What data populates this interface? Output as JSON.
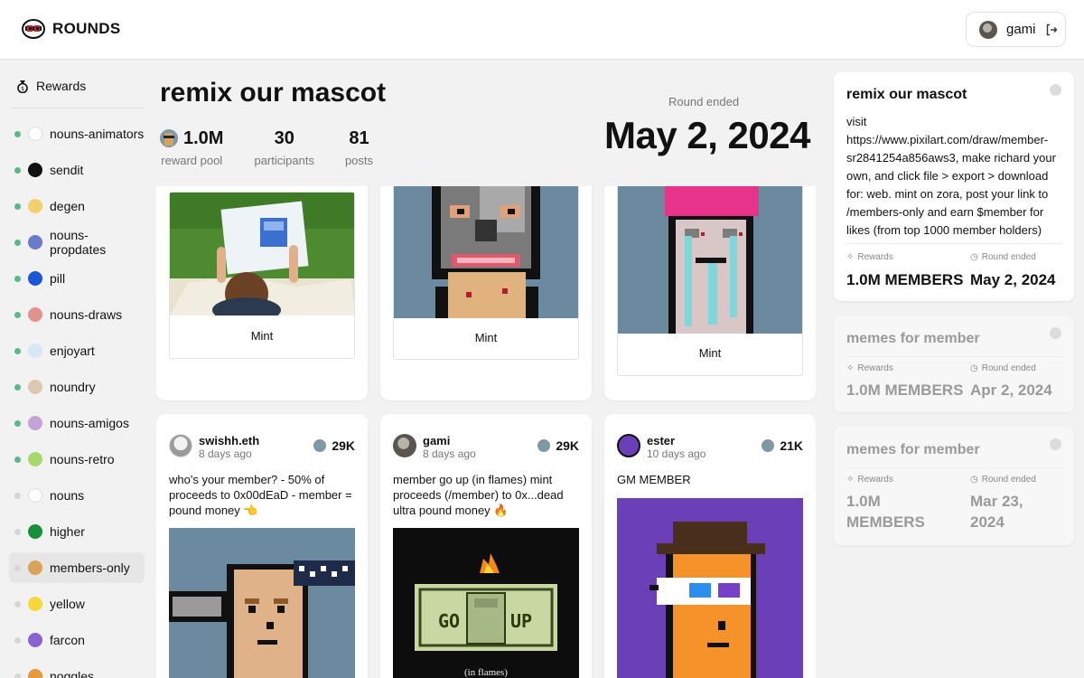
{
  "brand": {
    "name": "ROUNDS"
  },
  "user": {
    "name": "gami"
  },
  "sidebar": {
    "rewards_label": "Rewards",
    "channels": [
      {
        "label": "nouns-animators",
        "live": true,
        "icon_color": "#ffffff",
        "icon": "nouns-animators-icon"
      },
      {
        "label": "sendit",
        "live": true,
        "icon_color": "#111111",
        "icon": "sendit-icon"
      },
      {
        "label": "degen",
        "live": true,
        "icon_color": "#f3d16a",
        "icon": "degen-icon"
      },
      {
        "label": "nouns-propdates",
        "live": true,
        "icon_color": "#6b7ac9",
        "icon": "nouns-propdates-icon"
      },
      {
        "label": "pill",
        "live": true,
        "icon_color": "#1b58d6",
        "icon": "pill-icon"
      },
      {
        "label": "nouns-draws",
        "live": true,
        "icon_color": "#e1928b",
        "icon": "nouns-draws-icon"
      },
      {
        "label": "enjoyart",
        "live": true,
        "icon_color": "#d9e6f3",
        "icon": "enjoyart-icon"
      },
      {
        "label": "noundry",
        "live": true,
        "icon_color": "#dcc8b0",
        "icon": "noundry-icon"
      },
      {
        "label": "nouns-amigos",
        "live": true,
        "icon_color": "#c5a2d8",
        "icon": "nouns-amigos-icon"
      },
      {
        "label": "nouns-retro",
        "live": true,
        "icon_color": "#a7d86e",
        "icon": "nouns-retro-icon"
      },
      {
        "label": "nouns",
        "live": false,
        "icon_color": "#ffffff",
        "icon": "nouns-icon"
      },
      {
        "label": "higher",
        "live": false,
        "icon_color": "#1a8f3a",
        "icon": "higher-icon"
      },
      {
        "label": "members-only",
        "live": false,
        "icon_color": "#d9a35a",
        "icon": "members-only-icon",
        "active": true
      },
      {
        "label": "yellow",
        "live": false,
        "icon_color": "#f6d83a",
        "icon": "yellow-icon"
      },
      {
        "label": "farcon",
        "live": false,
        "icon_color": "#8a63d2",
        "icon": "farcon-icon"
      },
      {
        "label": "noggles",
        "live": false,
        "icon_color": "#e79a3a",
        "icon": "noggles-icon"
      }
    ]
  },
  "round": {
    "title": "remix our mascot",
    "reward_pool": "1.0M",
    "reward_pool_label": "reward pool",
    "participants": "30",
    "participants_label": "participants",
    "posts": "81",
    "posts_label": "posts",
    "status_label": "Round ended",
    "date": "May 2, 2024"
  },
  "feed": {
    "mint_cards": [
      {
        "mint_label": "Mint"
      },
      {
        "mint_label": "Mint"
      },
      {
        "mint_label": "Mint"
      }
    ],
    "posts": [
      {
        "author": "swishh.eth",
        "time": "8 days ago",
        "votes": "29K",
        "text": "who's your member? - 50% of proceeds to 0x00dEaD - member = pound money 👈"
      },
      {
        "author": "gami",
        "time": "8 days ago",
        "votes": "29K",
        "text": "member go up (in flames) mint proceeds (/member) to 0x...dead ultra pound money 🔥",
        "image_caption": "(in flames)"
      },
      {
        "author": "ester",
        "time": "10 days ago",
        "votes": "21K",
        "text": "GM MEMBER"
      }
    ]
  },
  "rounds_panel": [
    {
      "title": "remix our mascot",
      "description": "visit https://www.pixilart.com/draw/member-sr2841254a856aws3, make richard your own, and click file > export > download for: web. mint on zora, post your link to /members-only and earn $member for likes (from top 1000 member holders)",
      "rewards_label": "Rewards",
      "rewards_value": "1.0M MEMBERS",
      "ended_label": "Round ended",
      "ended_value": "May 2, 2024"
    },
    {
      "title": "memes for member",
      "rewards_label": "Rewards",
      "rewards_value": "1.0M MEMBERS",
      "ended_label": "Round ended",
      "ended_value": "Apr 2, 2024"
    },
    {
      "title": "memes for member",
      "rewards_label": "Rewards",
      "rewards_value": "1.0M MEMBERS",
      "ended_label": "Round ended",
      "ended_value": "Mar 23, 2024"
    }
  ],
  "colors": {
    "live_dot": "#5ab98a",
    "accent_pink": "#e8338a"
  }
}
